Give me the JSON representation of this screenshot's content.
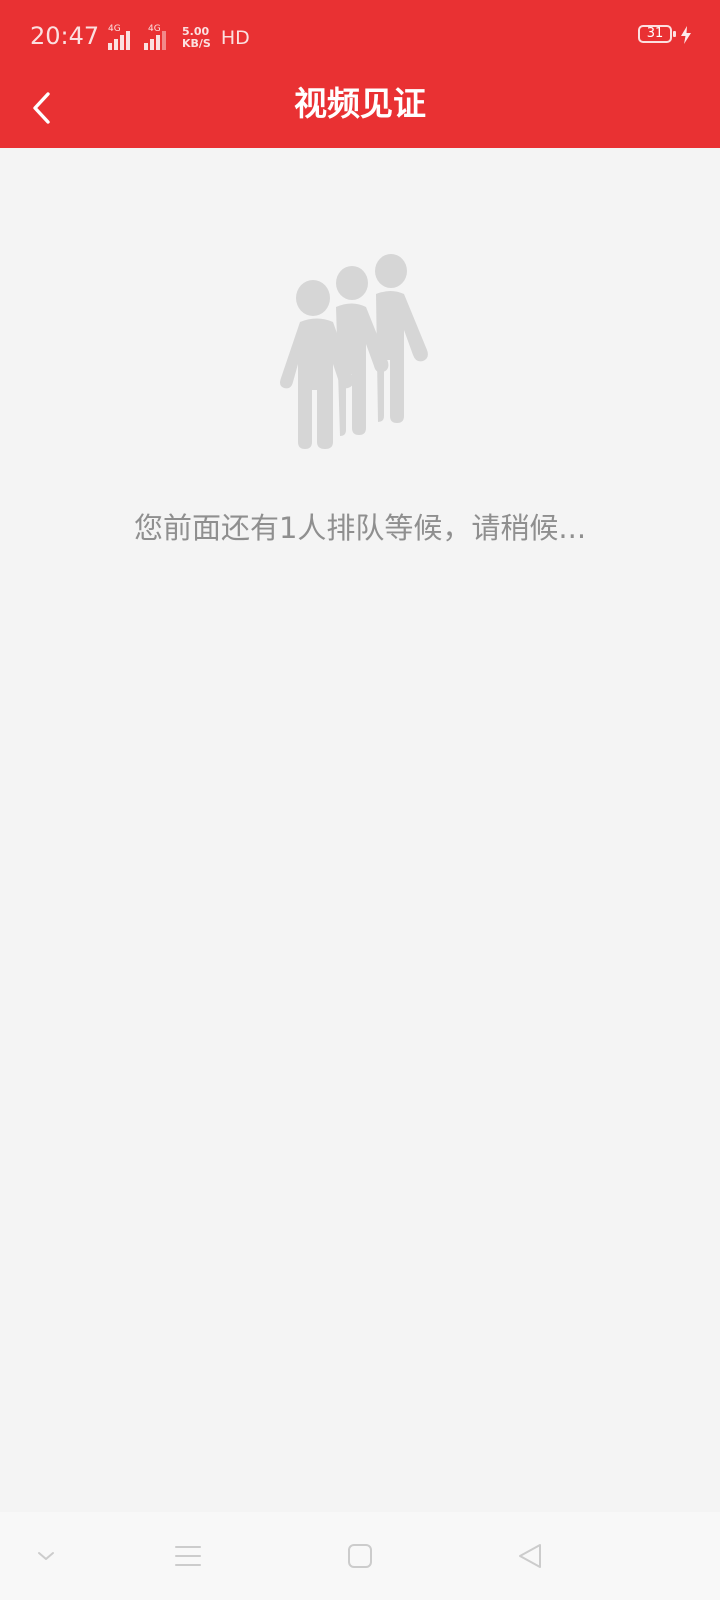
{
  "status_bar": {
    "time": "20:47",
    "network_1": "4G",
    "network_2": "4G",
    "speed_value": "5.00",
    "speed_unit": "KB/S",
    "hd": "HD",
    "battery": "31"
  },
  "header": {
    "title": "视频见证",
    "back_icon": "chevron-left-icon"
  },
  "queue": {
    "illustration_icon": "people-queue-icon",
    "message": "您前面还有1人排队等候，请稍候..."
  },
  "system_nav": {
    "items": [
      "chevron-down-icon",
      "menu-icon",
      "home-square-icon",
      "back-triangle-icon"
    ]
  },
  "colors": {
    "brand": "#e93133",
    "background": "#f4f4f4",
    "message_text": "#8f8f8f",
    "illustration": "#d6d6d6",
    "nav_icon": "#cccccc"
  }
}
